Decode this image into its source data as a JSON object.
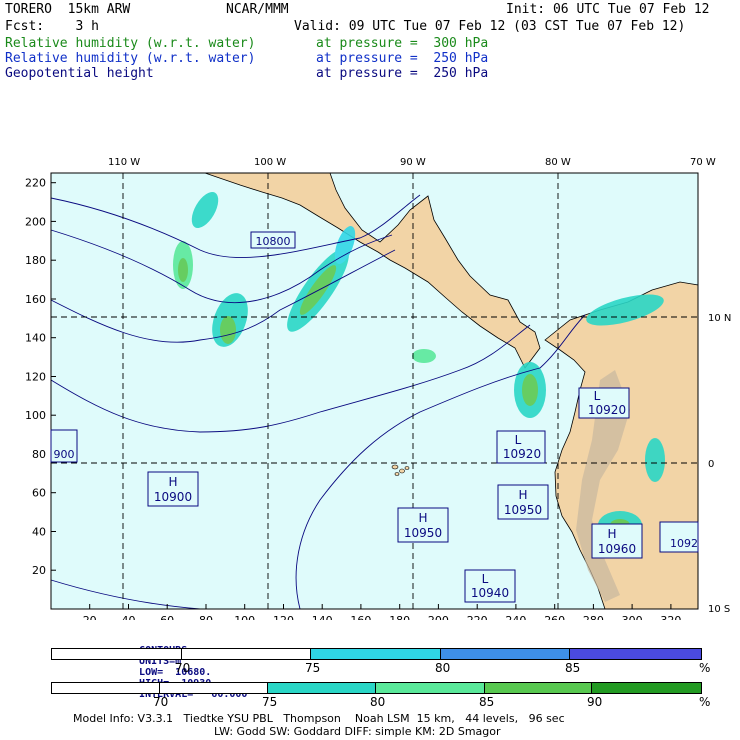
{
  "header": {
    "model": "TORERO  15km ARW",
    "org": "NCAR/MMM",
    "init": "Init: 06 UTC Tue 07 Feb 12",
    "fcst": "Fcst:    3 h",
    "valid": "Valid: 09 UTC Tue 07 Feb 12 (03 CST Tue 07 Feb 12)",
    "fields": [
      {
        "name": "Relative humidity (w.r.t. water)",
        "level": "at pressure =  300 hPa",
        "color": "#1a8a1a"
      },
      {
        "name": "Relative humidity (w.r.t. water)",
        "level": "at pressure =  250 hPa",
        "color": "#1030c8"
      },
      {
        "name": "Geopotential height",
        "level": "at pressure =  250 hPa",
        "color": "#0a0a80"
      }
    ]
  },
  "map": {
    "lon_labels": [
      "110 W",
      "100 W",
      "90 W",
      "80 W",
      "70 W"
    ],
    "lat_labels": [
      "10 N",
      "0",
      "10 S"
    ],
    "x_ticks": [
      20,
      40,
      60,
      80,
      100,
      120,
      140,
      160,
      180,
      200,
      220,
      240,
      260,
      280,
      300,
      320
    ],
    "y_ticks": [
      20,
      40,
      60,
      80,
      100,
      120,
      140,
      160,
      180,
      200,
      220
    ],
    "highs_lows": [
      {
        "type": "H",
        "value": "10900"
      },
      {
        "type": "H",
        "value": "10950"
      },
      {
        "type": "H",
        "value": "10950"
      },
      {
        "type": "H",
        "value": "10960"
      },
      {
        "type": "L",
        "value": "10920"
      },
      {
        "type": "L",
        "value": "10920"
      },
      {
        "type": "L",
        "value": "10940"
      }
    ],
    "contour_labels": [
      "10800",
      "900",
      "1092"
    ],
    "colors": {
      "ocean": "#dffbfb",
      "land": "#f2d4a6",
      "grid": "#000000",
      "contour": "#0a0a80"
    }
  },
  "contour_info": {
    "contours": "CONTOURS:",
    "units": "UNITS=m",
    "low": "LOW=  10680.",
    "high": "HIGH=  10930.",
    "interval": "INTERVAL=   60.000"
  },
  "colorbar_250": {
    "labels": [
      "70",
      "75",
      "80",
      "85",
      "%"
    ],
    "colors": [
      "#ffffff",
      "#ffffff",
      "#2fd6e6",
      "#3e8fe8",
      "#4a4ae0"
    ]
  },
  "colorbar_300": {
    "labels": [
      "70",
      "75",
      "80",
      "85",
      "90",
      "%"
    ],
    "colors": [
      "#ffffff",
      "#ffffff",
      "#2ad6c6",
      "#5ae89a",
      "#58c850",
      "#229a22"
    ]
  },
  "footer": {
    "line1": "Model Info: V3.3.1   Tiedtke YSU PBL   Thompson    Noah LSM  15 km,   44 levels,   96 sec",
    "line2": "LW: Godd SW: Goddard DIFF: simple KM: 2D Smagor"
  }
}
